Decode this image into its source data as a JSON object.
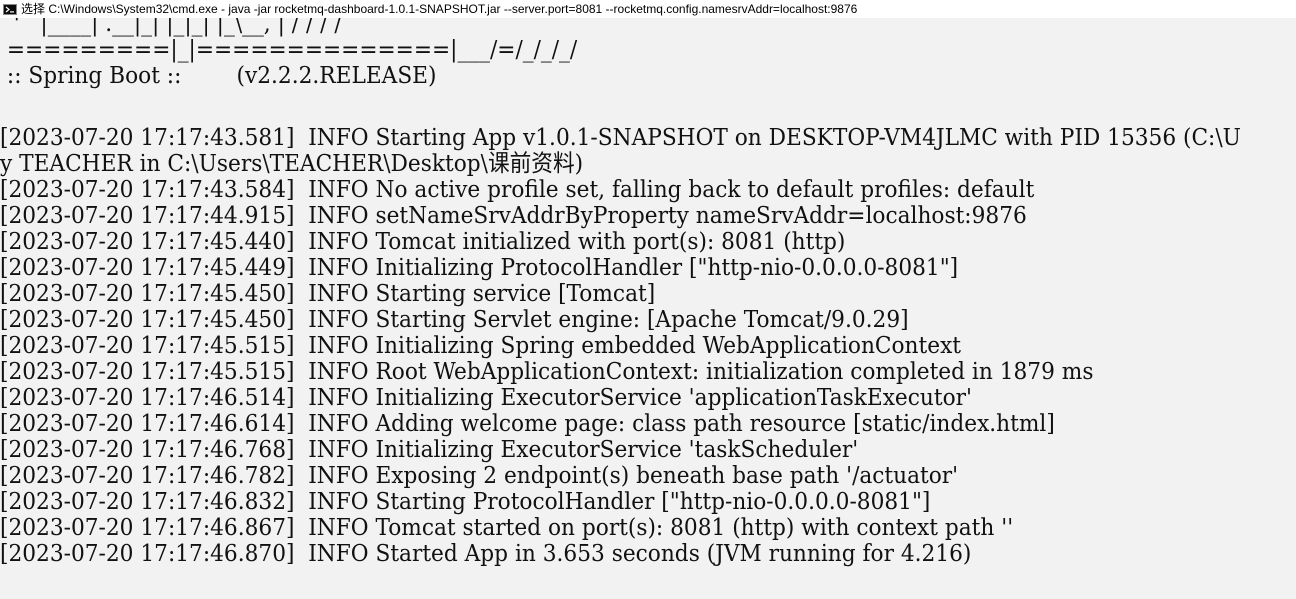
{
  "window": {
    "title": "选择 C:\\Windows\\System32\\cmd.exe - java  -jar rocketmq-dashboard-1.0.1-SNAPSHOT.jar --server.port=8081 --rocketmq.config.namesrvAddr=localhost:9876",
    "icon": "cmd-icon"
  },
  "banner": {
    "art_line_1": "  '   |____| .__|_| |_|_| |_\\__, | / / / /",
    "art_line_2": " =========|_|==============|___/=/_/_/_/",
    "spring_boot_line": " :: Spring Boot ::        (v2.2.2.RELEASE)"
  },
  "log": [
    "[2023-07-20 17:17:43.581]  INFO Starting App v1.0.1-SNAPSHOT on DESKTOP-VM4JLMC with PID 15356 (C:\\U",
    "y TEACHER in C:\\Users\\TEACHER\\Desktop\\课前资料)",
    "[2023-07-20 17:17:43.584]  INFO No active profile set, falling back to default profiles: default",
    "[2023-07-20 17:17:44.915]  INFO setNameSrvAddrByProperty nameSrvAddr=localhost:9876",
    "[2023-07-20 17:17:45.440]  INFO Tomcat initialized with port(s): 8081 (http)",
    "[2023-07-20 17:17:45.449]  INFO Initializing ProtocolHandler [\"http-nio-0.0.0.0-8081\"]",
    "[2023-07-20 17:17:45.450]  INFO Starting service [Tomcat]",
    "[2023-07-20 17:17:45.450]  INFO Starting Servlet engine: [Apache Tomcat/9.0.29]",
    "[2023-07-20 17:17:45.515]  INFO Initializing Spring embedded WebApplicationContext",
    "[2023-07-20 17:17:45.515]  INFO Root WebApplicationContext: initialization completed in 1879 ms",
    "[2023-07-20 17:17:46.514]  INFO Initializing ExecutorService 'applicationTaskExecutor'",
    "[2023-07-20 17:17:46.614]  INFO Adding welcome page: class path resource [static/index.html]",
    "[2023-07-20 17:17:46.768]  INFO Initializing ExecutorService 'taskScheduler'",
    "[2023-07-20 17:17:46.782]  INFO Exposing 2 endpoint(s) beneath base path '/actuator'",
    "[2023-07-20 17:17:46.832]  INFO Starting ProtocolHandler [\"http-nio-0.0.0.0-8081\"]",
    "[2023-07-20 17:17:46.867]  INFO Tomcat started on port(s): 8081 (http) with context path ''",
    "[2023-07-20 17:17:46.870]  INFO Started App in 3.653 seconds (JVM running for 4.216)"
  ],
  "colors": {
    "console_background": "#f2f2f2",
    "console_text": "#111111",
    "titlebar_background": "#ffffff"
  }
}
